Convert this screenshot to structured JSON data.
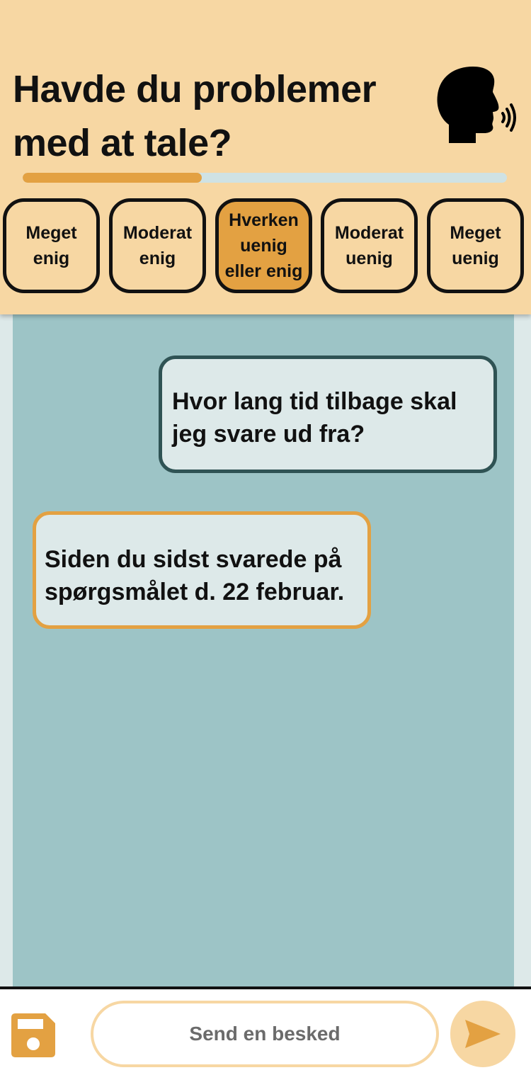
{
  "header": {
    "title": "Havde du problemer med at tale?",
    "icon": "speaking-head-icon",
    "progress_fraction": 0.37
  },
  "answer_options": [
    {
      "label": "Meget enig",
      "selected": false
    },
    {
      "label": "Moderat enig",
      "selected": false
    },
    {
      "label": "Hverken uenig eller enig",
      "selected": true
    },
    {
      "label": "Moderat uenig",
      "selected": false
    },
    {
      "label": "Meget uenig",
      "selected": false
    }
  ],
  "chat": {
    "messages": [
      {
        "from": "user",
        "text": "Hvor lang tid tilbage skal jeg svare ud fra?"
      },
      {
        "from": "bot",
        "text": "Siden du sidst svarede på spørgsmålet d. 22 februar."
      }
    ]
  },
  "composer": {
    "placeholder": "Send en besked",
    "value": "",
    "save_icon": "floppy-disk-icon",
    "send_icon": "send-arrow-icon"
  },
  "colors": {
    "header_bg": "#f7d7a3",
    "accent": "#e3a142",
    "chat_bg": "#9dc4c6",
    "bubble_bg": "#dde9e9",
    "user_border": "#2f5354"
  }
}
